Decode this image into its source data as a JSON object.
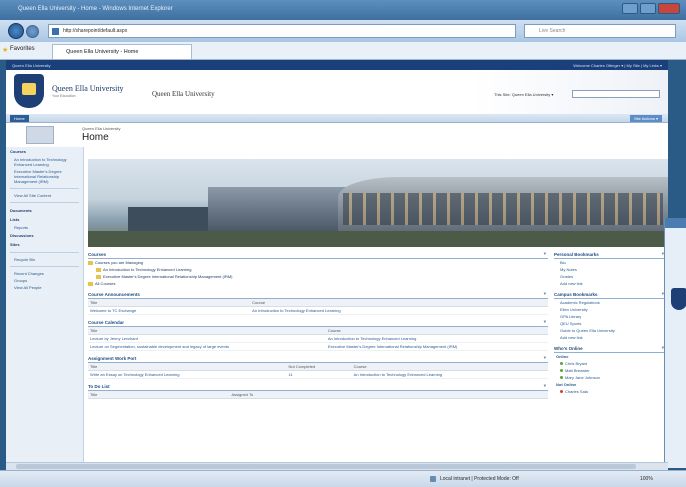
{
  "browser": {
    "title": "Queen Ella University - Home - Windows Internet Explorer",
    "url": "http://sharepoint/default.aspx",
    "search_placeholder": "Live Search",
    "favorites_label": "Favorites",
    "tab_label": "Queen Ella University - Home",
    "status_zone": "Local intranet | Protected Mode: Off",
    "zoom": "100%"
  },
  "site": {
    "top_left": "Queen Ella University",
    "top_right": "Welcome Charles Ottinger ▾  |  My Site  |  My Links ▾",
    "name": "Queen Ella University",
    "tagline": "Your Education",
    "name_alt": "Queen Ella University",
    "search_label": "This Site: Queen Ella University ▾",
    "nav_home": "Home",
    "site_actions": "Site Actions ▾",
    "breadcrumb": "Queen Ella University",
    "page_title": "Home"
  },
  "quicklaunch": {
    "courses_header": "Courses",
    "courses": [
      "An Introduction to Technology Enhanced Learning",
      "Executive Master's Degree International Relationship Management (IRM)"
    ],
    "view_all": "View All Site Content",
    "documents_header": "Documents",
    "lists_header": "Lists",
    "reports": "Reports",
    "discussions_header": "Discussions",
    "sites_header": "Sites",
    "recycle_bin": "Recycle Bin",
    "recent_changes": "Recent Changes",
    "groups": "Groups",
    "people": "View All People"
  },
  "main": {
    "courses_panel": {
      "header": "Courses",
      "managing": "Courses you are Managing",
      "items": [
        "An Introduction to Technology Enhanced Learning",
        "Executive Master's Degree International Relationship Management (IRM)"
      ],
      "all": "All Courses"
    },
    "announcements": {
      "header": "Course Announcements",
      "cols": [
        "Title",
        "Course"
      ],
      "rows": [
        [
          "Welcome to TC Exchange",
          "An Introduction to Technology Enhanced Learning"
        ]
      ]
    },
    "calendar": {
      "header": "Course Calendar",
      "cols": [
        "Title",
        "Course"
      ],
      "rows": [
        [
          "Lecture by Jenny Levchant",
          "An Introduction to Technology Enhanced Learning"
        ],
        [
          "Lecture on Segmentation, sustainable development and legacy of large events",
          "Executive Master's Degree International Relationship Management (IRM)"
        ]
      ]
    },
    "assignments": {
      "header": "Assignment Work Port",
      "cols": [
        "Title",
        "Not Completed",
        "Course"
      ],
      "rows": [
        [
          "Write an Essay on Technology Enhanced Learning",
          "11",
          "An Introduction to Technology Enhanced Learning"
        ]
      ]
    },
    "todo": {
      "header": "To Do List",
      "cols": [
        "Title",
        "Assigned To"
      ]
    }
  },
  "right": {
    "personal": {
      "header": "Personal Bookmarks",
      "items": [
        "Bio",
        "My Notes",
        "Grades"
      ],
      "add": "Add new link"
    },
    "campus": {
      "header": "Campus Bookmarks",
      "items": [
        "Academic Regulations",
        "Ellen University",
        "GPA Library",
        "QEU Sports",
        "Guide to Queen Ella University"
      ],
      "add": "Add new link"
    },
    "online": {
      "header": "Who's Online",
      "online_label": "Online",
      "online_users": [
        "Chris Bryant",
        "Matt Brewster",
        "Mary Jane Johnson"
      ],
      "offline_label": "Not Online",
      "offline_users": [
        "Charles Sala"
      ],
      "status_colors": {
        "online": "#5aa53a",
        "offline": "#c9463d"
      }
    }
  },
  "colors": {
    "brand": "#1b3f7a",
    "link": "#2a5a8f",
    "accent": "#f4d35e"
  }
}
